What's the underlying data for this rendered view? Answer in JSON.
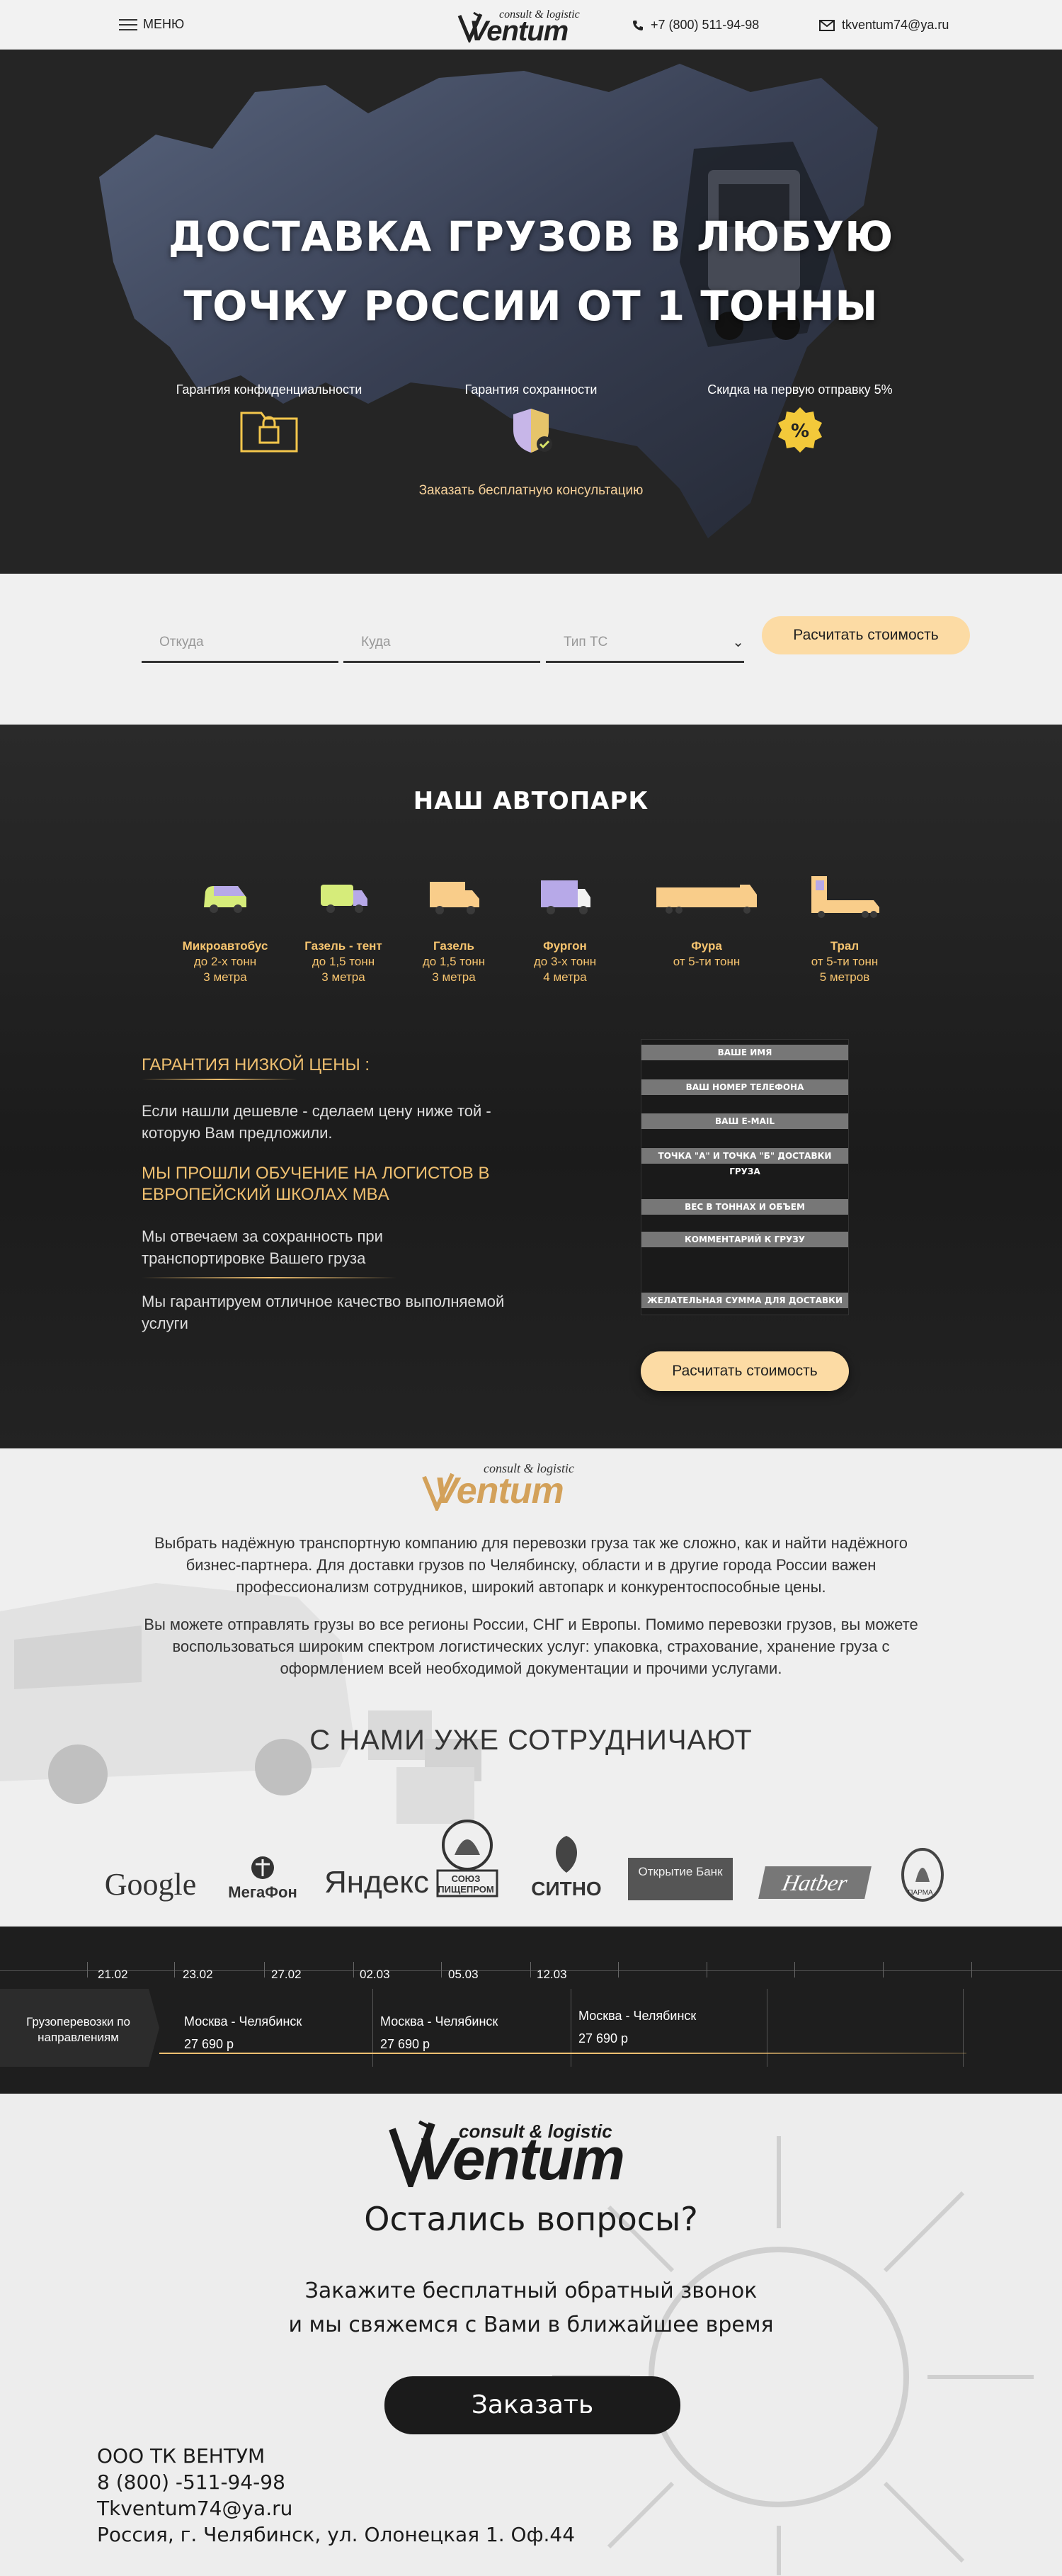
{
  "header": {
    "menu_label": "МЕНЮ",
    "logo": {
      "top": "consult & logistic",
      "name": "Ventum"
    },
    "phone": "+7 (800) 511-94-98",
    "email": "tkventum74@ya.ru"
  },
  "hero": {
    "title_line1": "ДОСТАВКА ГРУЗОВ В ЛЮБУЮ",
    "title_line2": "ТОЧКУ РОССИИ ОТ 1 ТОННЫ",
    "features": [
      {
        "label": "Гарантия конфиденциальности",
        "icon": "folder-lock-icon"
      },
      {
        "label": "Гарантия сохранности",
        "icon": "shield-check-icon"
      },
      {
        "label": "Скидка на первую отправку 5%",
        "icon": "percent-badge-icon"
      }
    ],
    "cta": "Заказать бесплатную консультацию"
  },
  "calculator": {
    "from_placeholder": "Откуда",
    "to_placeholder": "Куда",
    "type_placeholder": "Тип ТС",
    "button": "Расчитать стоимость"
  },
  "fleet": {
    "title": "НАШ АВТОПАРК",
    "vehicles": [
      {
        "name": "Микроавтобус",
        "line2": "до 2-х тонн",
        "line3": "3 метра"
      },
      {
        "name": "Газель - тент",
        "line2": "до 1,5 тонн",
        "line3": "3 метра"
      },
      {
        "name": "Газель",
        "line2": "до 1,5 тонн",
        "line3": "3 метра"
      },
      {
        "name": "Фургон",
        "line2": "до 3-х тонн",
        "line3": "4 метра"
      },
      {
        "name": "Фура",
        "line2": "от 5-ти тонн",
        "line3": ""
      },
      {
        "name": "Трал",
        "line2": "от 5-ти тонн",
        "line3": "5 метров"
      }
    ],
    "benefits": {
      "h1": "ГАРАНТИЯ НИЗКОЙ ЦЕНЫ :",
      "t1": "Если нашли дешевле - сделаем цену ниже той - которую Вам предложили.",
      "h2": "МЫ ПРОШЛИ ОБУЧЕНИЕ НА ЛОГИСТОВ В ЕВРОПЕЙСКИЙ ШКОЛАХ MBA",
      "t2": "Мы отвечаем за сохранность при транспортировке Вашего груза",
      "t3": "Мы гарантируем отличное качество выполняемой услуги"
    },
    "form": {
      "name": "ВАШЕ ИМЯ",
      "phone": "ВАШ НОМЕР ТЕЛЕФОНА",
      "email": "ВАШ E-MAIL",
      "route": "ТОЧКА \"А\" И ТОЧКА \"Б\" ДОСТАВКИ ГРУЗА",
      "weight": "ВЕС В ТОННАХ И ОБЪЕМ",
      "comment": "КОММЕНТАРИЙ К ГРУЗУ",
      "price": "ЖЕЛАТЕЛЬНАЯ СУММА ДЛЯ ДОСТАВКИ",
      "button": "Расчитать стоимость"
    }
  },
  "about": {
    "logo": {
      "top": "consult & logistic",
      "name": "Ventum"
    },
    "p1": "Выбрать надёжную транспортную компанию для перевозки груза так же сложно, как и найти надёжного бизнес-партнера. Для доставки грузов по Челябинску, области и в другие города России важен профессионализм сотрудников, широкий автопарк и конкурентоспособные цены.",
    "p2": "Вы можете отправлять грузы во все регионы России, СНГ и Европы. Помимо перевозки грузов, вы можете воспользоваться широким спектром логистических услуг: упаковка, страхование, хранение груза с оформлением всей необходимой документации и прочими услугами.",
    "partners_title": "С НАМИ УЖЕ СОТРУДНИЧАЮТ",
    "partners": [
      "Google",
      "МегаФон",
      "Яндекс",
      "СОЮЗ ПИЩЕПРОМ",
      "СИТНО",
      "Открытие Банк",
      "Hatber",
      "ПАРМА"
    ]
  },
  "timeline": {
    "dates": [
      "21.02",
      "23.02",
      "27.02",
      "02.03",
      "05.03",
      "12.03"
    ],
    "label": "Грузоперевозки по направлениям",
    "routes": [
      {
        "route": "Москва - Челябинск",
        "price": "27 690 р"
      },
      {
        "route": "Москва - Челябинск",
        "price": "27 690 р"
      },
      {
        "route": "Москва - Челябинск",
        "price": "27 690 р"
      }
    ]
  },
  "footer": {
    "logo": {
      "top": "consult & logistic",
      "name": "Ventum"
    },
    "question": "Остались вопросы?",
    "sub1": "Закажите бесплатный обратный звонок",
    "sub2": "и мы свяжемся с Вами в ближайшее время",
    "button": "Заказать",
    "company": "ООО ТК ВЕНТУМ",
    "phone": "8 (800) -511-94-98",
    "email": "Tkventum74@ya.ru",
    "address": "Россия, г. Челябинск, ул. Олонецкая 1. Оф.44"
  },
  "colors": {
    "accent": "#fcdba4",
    "gold": "#f0c070",
    "dark": "#1b1b1b"
  }
}
